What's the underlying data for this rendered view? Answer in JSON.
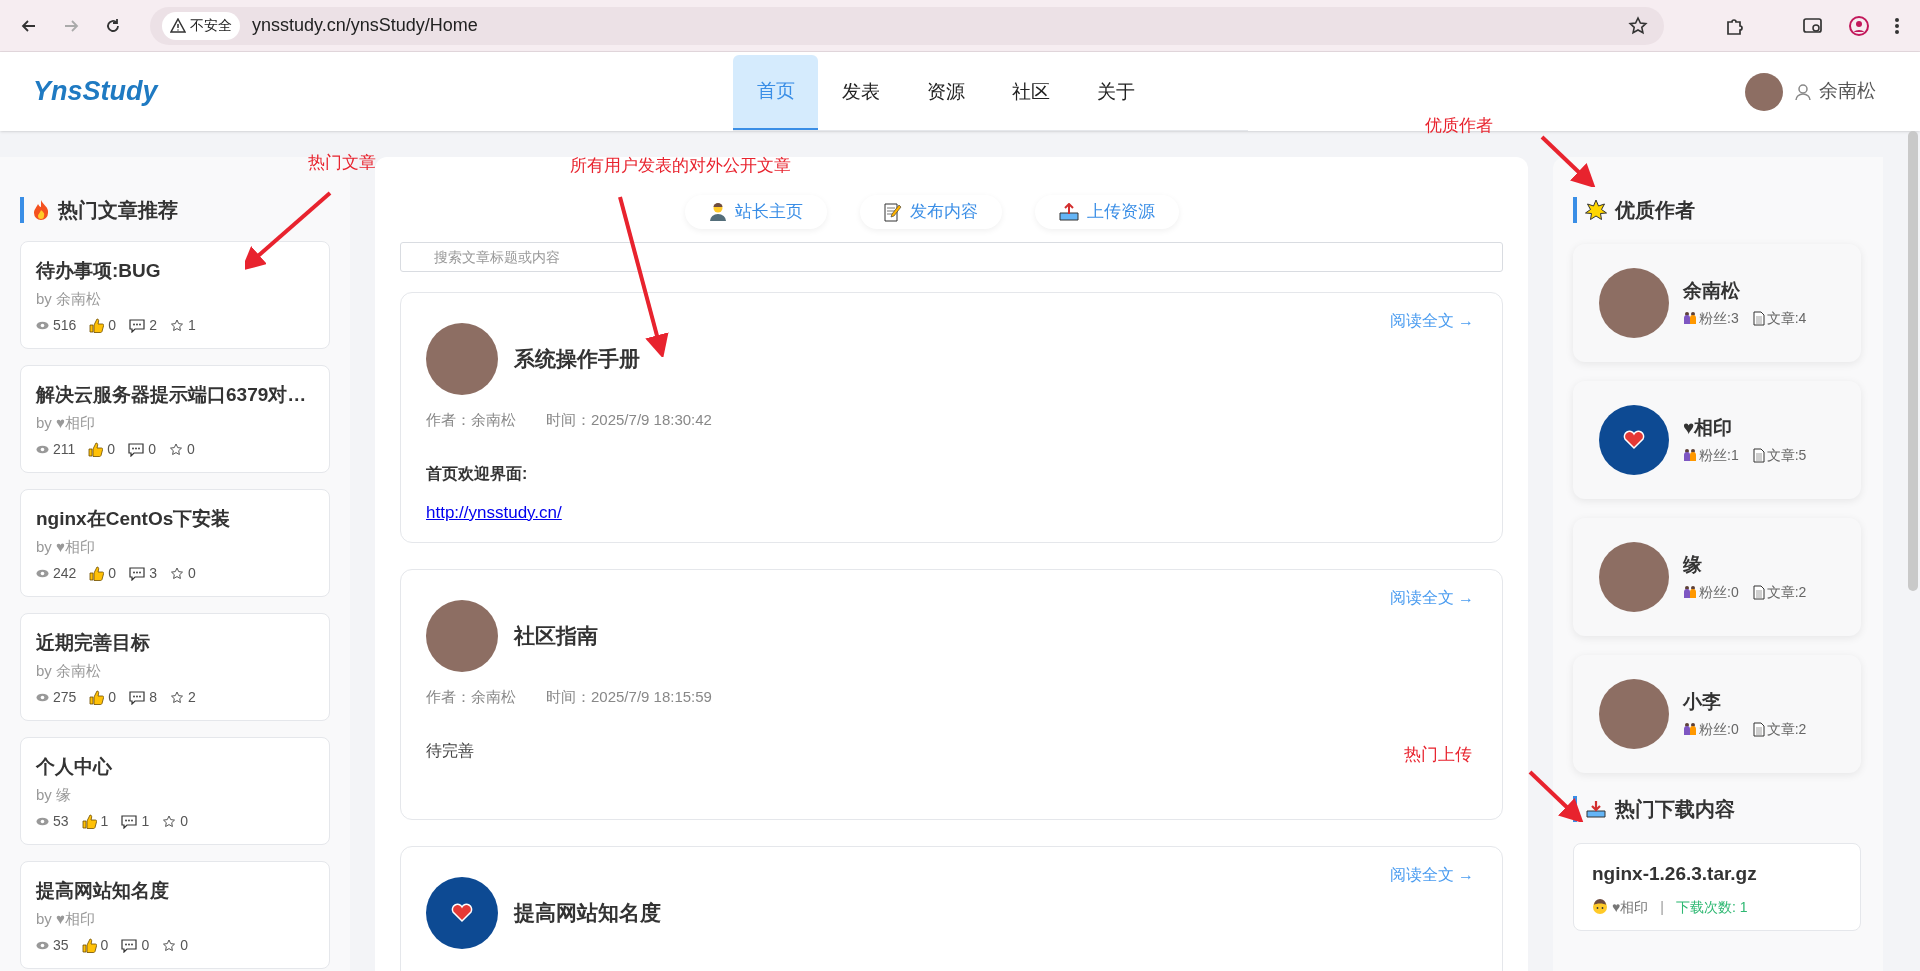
{
  "browser": {
    "security_label": "不安全",
    "url": "ynsstudy.cn/ynsStudy/Home"
  },
  "header": {
    "logo": "YnsStudy",
    "nav": [
      {
        "label": "首页",
        "selected": true
      },
      {
        "label": "发表",
        "selected": false
      },
      {
        "label": "资源",
        "selected": false
      },
      {
        "label": "社区",
        "selected": false
      },
      {
        "label": "关于",
        "selected": false
      }
    ],
    "user": {
      "name": "余南松"
    }
  },
  "hot_articles": {
    "title": "热门文章推荐",
    "items": [
      {
        "title": "待办事项:BUG",
        "author": "by 余南松",
        "views": "516",
        "likes": "0",
        "comments": "2",
        "favorites": "1"
      },
      {
        "title": "解决云服务器提示端口6379对…",
        "author": "by ♥相印",
        "views": "211",
        "likes": "0",
        "comments": "0",
        "favorites": "0"
      },
      {
        "title": "nginx在CentOs下安装",
        "author": "by ♥相印",
        "views": "242",
        "likes": "0",
        "comments": "3",
        "favorites": "0"
      },
      {
        "title": "近期完善目标",
        "author": "by 余南松",
        "views": "275",
        "likes": "0",
        "comments": "8",
        "favorites": "2"
      },
      {
        "title": "个人中心",
        "author": "by 缘",
        "views": "53",
        "likes": "1",
        "comments": "1",
        "favorites": "0"
      },
      {
        "title": "提高网站知名度",
        "author": "by ♥相印",
        "views": "35",
        "likes": "0",
        "comments": "0",
        "favorites": "0"
      }
    ]
  },
  "center": {
    "actions": [
      {
        "kind": "person",
        "label": "站长主页"
      },
      {
        "kind": "memo",
        "label": "发布内容"
      },
      {
        "kind": "upload",
        "label": "上传资源"
      }
    ],
    "search": {
      "placeholder": "搜索文章标题或内容"
    },
    "articles": [
      {
        "avatar": {
          "kind": "photo"
        },
        "title": "系统操作手册",
        "author": "作者：余南松",
        "time": "时间：2025/7/9 18:30:42",
        "read_more": "阅读全文 →",
        "content": [
          {
            "kind": "bold",
            "text": "首页欢迎界面:"
          },
          {
            "kind": "link",
            "text": "http://ynsstudy.cn/"
          }
        ]
      },
      {
        "avatar": {
          "kind": "photo"
        },
        "title": "社区指南",
        "author": "作者：余南松",
        "time": "时间：2025/7/9 18:15:59",
        "read_more": "阅读全文 →",
        "content": [
          {
            "kind": "plain",
            "text": "待完善"
          }
        ]
      },
      {
        "avatar": {
          "kind": "logo"
        },
        "title": "提高网站知名度",
        "read_more": "阅读全文 →"
      }
    ]
  },
  "top_authors": {
    "title": "优质作者",
    "items": [
      {
        "avatar": {
          "kind": "photo"
        },
        "name": "余南松",
        "fans": "粉丝:3",
        "articles": "文章:4"
      },
      {
        "avatar": {
          "kind": "logo"
        },
        "name": "♥相印",
        "fans": "粉丝:1",
        "articles": "文章:5"
      },
      {
        "avatar": {
          "kind": "photo"
        },
        "name": "缘",
        "fans": "粉丝:0",
        "articles": "文章:2"
      },
      {
        "avatar": {
          "kind": "photo"
        },
        "name": "小李",
        "fans": "粉丝:0",
        "articles": "文章:2"
      }
    ]
  },
  "hot_downloads": {
    "title": "热门下载内容",
    "items": [
      {
        "name": "nginx-1.26.3.tar.gz",
        "uploader": "♥相印",
        "separator": "|",
        "downloads": "下载次数: 1"
      }
    ]
  },
  "annotations": [
    {
      "text": "热门文章"
    },
    {
      "text": "所有用户发表的对外公开文章"
    },
    {
      "text": "优质作者"
    },
    {
      "text": "热门上传"
    }
  ]
}
